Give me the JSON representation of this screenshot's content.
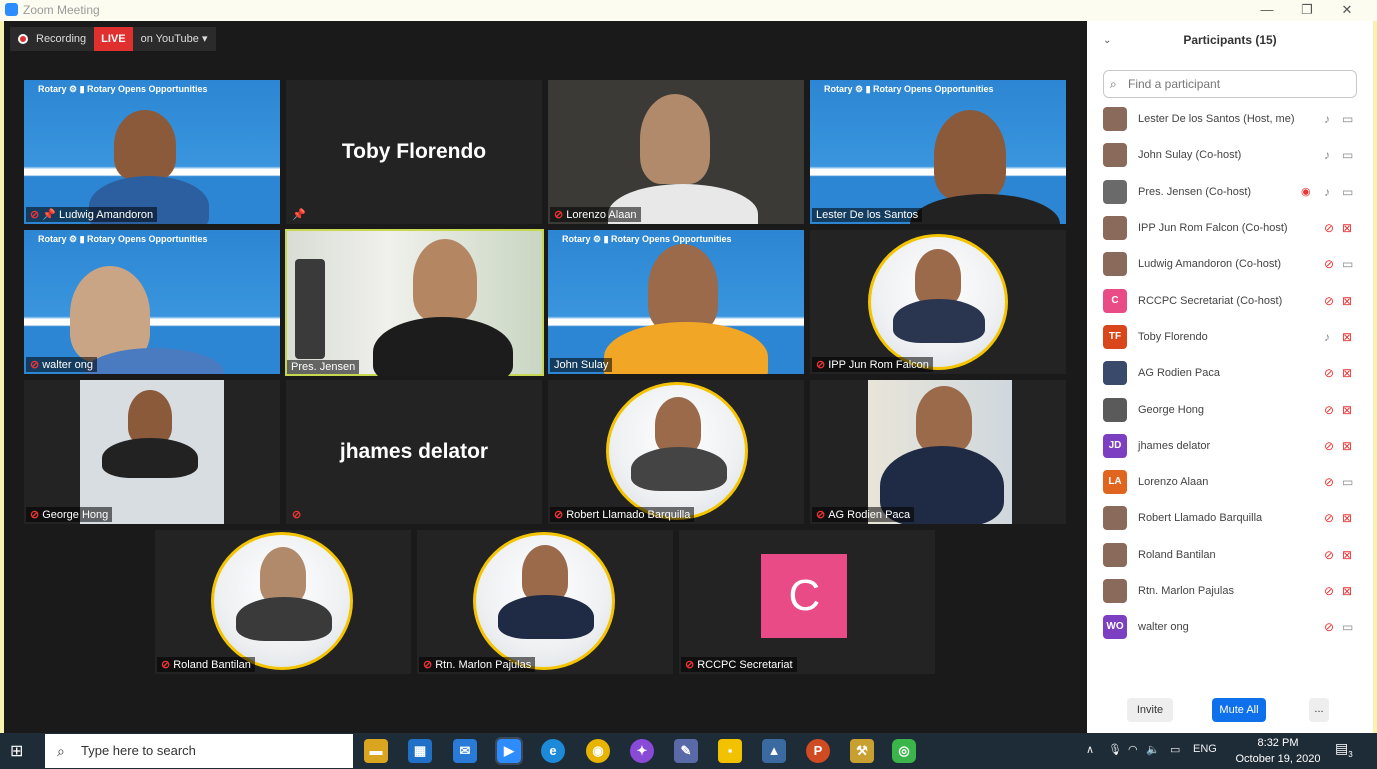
{
  "window": {
    "title": "Zoom Meeting",
    "minimize": "—",
    "restore": "❐",
    "close": "✕"
  },
  "recording": {
    "label": "Recording",
    "live": "LIVE",
    "stream": "on YouTube ▾"
  },
  "tiles": {
    "t1": "Ludwig Amandoron",
    "t2": "Toby Florendo",
    "t3": "Lorenzo Alaan",
    "t4": "Lester De los Santos",
    "t5": "walter ong",
    "t6": "Pres. Jensen",
    "t7": "John Sulay",
    "t8": "IPP Jun Rom Falcon",
    "t9": "George Hong",
    "t10": "jhames delator",
    "t11": "Robert Llamado Barquilla",
    "t12": "AG Rodien Paca",
    "t13": "Roland Bantilan",
    "t14": "Rtn. Marlon Pajulas",
    "t15": "RCCPC Secretariat",
    "rotary": "Rotary",
    "rotary_tag": "Rotary Opens Opportunities",
    "secretariat_initial": "C"
  },
  "panel": {
    "title": "Participants (15)",
    "search_placeholder": "Find a participant",
    "participants": [
      {
        "name": "Lester De los Santos (Host, me)",
        "initials": "",
        "color": "#8a6a5a"
      },
      {
        "name": "John Sulay (Co-host)",
        "initials": "",
        "color": "#8a6a5a"
      },
      {
        "name": "Pres. Jensen (Co-host)",
        "initials": "",
        "color": "#6a6a6a"
      },
      {
        "name": "IPP Jun Rom Falcon (Co-host)",
        "initials": "",
        "color": "#8a6a5a"
      },
      {
        "name": "Ludwig Amandoron (Co-host)",
        "initials": "",
        "color": "#8a6a5a"
      },
      {
        "name": "RCCPC Secretariat (Co-host)",
        "initials": "C",
        "color": "#e94b87"
      },
      {
        "name": "Toby Florendo",
        "initials": "TF",
        "color": "#d9461b"
      },
      {
        "name": "AG Rodien Paca",
        "initials": "",
        "color": "#3a4a6a"
      },
      {
        "name": "George Hong",
        "initials": "",
        "color": "#5a5a5a"
      },
      {
        "name": "jhames delator",
        "initials": "JD",
        "color": "#7d3fc2"
      },
      {
        "name": "Lorenzo Alaan",
        "initials": "LA",
        "color": "#e0661f"
      },
      {
        "name": "Robert Llamado Barquilla",
        "initials": "",
        "color": "#8a6a5a"
      },
      {
        "name": "Roland Bantilan",
        "initials": "",
        "color": "#8a6a5a"
      },
      {
        "name": "Rtn. Marlon Pajulas",
        "initials": "",
        "color": "#8a6a5a"
      },
      {
        "name": "walter ong",
        "initials": "WO",
        "color": "#7d3fc2"
      }
    ],
    "invite": "Invite",
    "mute_all": "Mute All",
    "more": "..."
  },
  "taskbar": {
    "search_placeholder": "Type here to search",
    "language": "ENG",
    "time": "8:32 PM",
    "date": "October 19, 2020",
    "notification_count": "3"
  }
}
